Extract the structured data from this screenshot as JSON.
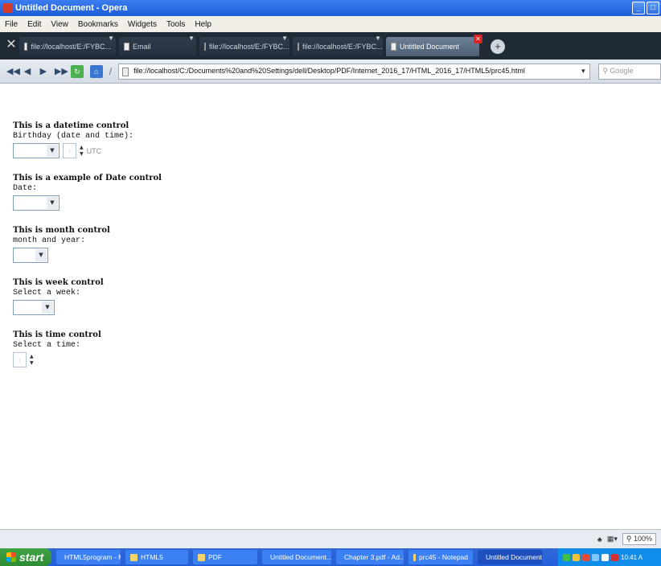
{
  "window": {
    "title": "Untitled Document - Opera"
  },
  "menu": [
    "File",
    "Edit",
    "View",
    "Bookmarks",
    "Widgets",
    "Tools",
    "Help"
  ],
  "tabs": [
    {
      "label": "file://localhost/E:/FYBC..."
    },
    {
      "label": "Email"
    },
    {
      "label": "file://localhost/E:/FYBC..."
    },
    {
      "label": "file://localhost/E:/FYBC..."
    },
    {
      "label": "Untitled Document"
    }
  ],
  "address": {
    "url": "file://localhost/C:/Documents%20and%20Settings/dell/Desktop/PDF/Internet_2016_17/HTML_2016_17/HTML5/prc45.html",
    "search_placeholder": "Google"
  },
  "page": {
    "sections": [
      {
        "heading": "This is a datetime control",
        "label": "Birthday (date and time):",
        "suffix": "UTC"
      },
      {
        "heading": "This is a example of Date control",
        "label": "Date:"
      },
      {
        "heading": "This is month control",
        "label": "month and year:"
      },
      {
        "heading": "This is week control",
        "label": "Select a week:"
      },
      {
        "heading": "This is time control",
        "label": "Select a time:"
      }
    ]
  },
  "status": {
    "zoom": "100%"
  },
  "taskbar": {
    "start": "start",
    "items": [
      "HTML5program - M...",
      "HTML5",
      "PDF",
      "Untitled Document...",
      "Chapter 3.pdf - Ad...",
      "prc45 - Notepad",
      "Untitled Document ..."
    ],
    "clock": "10:41 A"
  },
  "colors": {
    "titlebar": "#2a6be0",
    "tabbar": "#1f2a36",
    "taskbar": "#245edb",
    "start": "#36963b"
  }
}
